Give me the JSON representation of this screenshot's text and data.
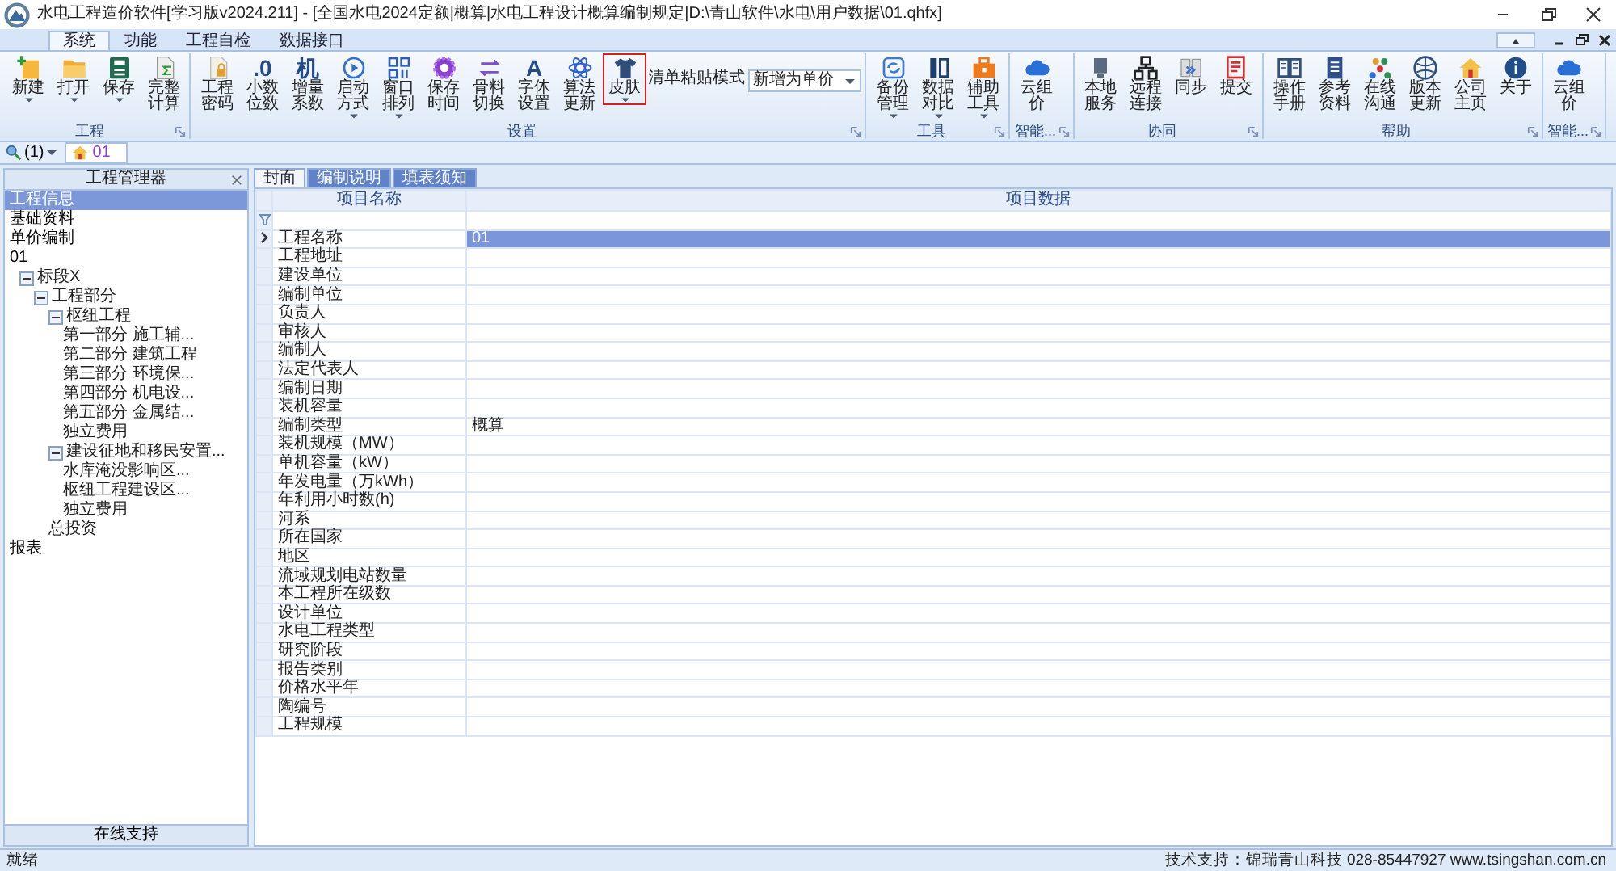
{
  "window": {
    "title": "水电工程造价软件[学习版v2024.211] - [全国水电2024定额|概算|水电工程设计概算编制规定|D:\\青山软件\\水电\\用户数据\\01.qhfx]"
  },
  "ribbon": {
    "tabs": [
      {
        "label": "系统",
        "selected": true
      },
      {
        "label": "功能",
        "selected": false
      },
      {
        "label": "工程自检",
        "selected": false
      },
      {
        "label": "数据接口",
        "selected": false
      }
    ],
    "groups": [
      {
        "label": "工程",
        "items": [
          {
            "label": "新建",
            "kind": "new",
            "dropdown": true,
            "selected": false
          },
          {
            "label": "打开",
            "kind": "folder",
            "dropdown": true,
            "selected": false
          },
          {
            "label": "保存",
            "kind": "disk",
            "dropdown": true,
            "selected": false
          },
          {
            "label": "完整计算",
            "kind": "sigma",
            "dropdown": false,
            "selected": false
          }
        ]
      },
      {
        "label": "设置",
        "items": [
          {
            "label": "工程密码",
            "kind": "lockdoc",
            "dropdown": false,
            "selected": false
          },
          {
            "label": "小数位数",
            "kind": "glyph",
            "glyph": ".0",
            "dropdown": false,
            "selected": false
          },
          {
            "label": "增量系数",
            "kind": "glyph",
            "glyph": "机",
            "dropdown": false,
            "selected": false
          },
          {
            "label": "启动方式",
            "kind": "play",
            "dropdown": true,
            "selected": false
          },
          {
            "label": "窗口排列",
            "kind": "grid",
            "dropdown": true,
            "selected": false
          },
          {
            "label": "保存时间",
            "kind": "gear",
            "dropdown": false,
            "selected": false
          },
          {
            "label": "骨料切换",
            "kind": "swap",
            "dropdown": false,
            "selected": false
          },
          {
            "label": "字体设置",
            "kind": "glyph",
            "glyph": "A",
            "dropdown": false,
            "selected": false
          },
          {
            "label": "算法更新",
            "kind": "atom",
            "dropdown": false,
            "selected": false
          },
          {
            "label": "皮肤",
            "kind": "shirt",
            "dropdown": true,
            "selected": true
          }
        ],
        "combo": {
          "label": "清单粘贴模式",
          "value": "新增为单价"
        }
      },
      {
        "label": "工具",
        "items": [
          {
            "label": "备份管理",
            "kind": "sync",
            "dropdown": true,
            "selected": false
          },
          {
            "label": "数据对比",
            "kind": "columns",
            "dropdown": true,
            "selected": false
          },
          {
            "label": "辅助工具",
            "kind": "toolbox",
            "dropdown": true,
            "selected": false
          }
        ]
      },
      {
        "label": "智能...",
        "items": [
          {
            "label": "云组价",
            "kind": "cloud",
            "dropdown": false,
            "selected": false
          }
        ]
      },
      {
        "label": "协同",
        "items": [
          {
            "label": "本地服务",
            "kind": "server",
            "dropdown": false,
            "selected": false
          },
          {
            "label": "远程连接",
            "kind": "network",
            "dropdown": false,
            "selected": false
          },
          {
            "label": "同步",
            "kind": "bookarrow",
            "dropdown": false,
            "selected": false
          },
          {
            "label": "提交",
            "kind": "redlist",
            "dropdown": false,
            "selected": false
          }
        ]
      },
      {
        "label": "帮助",
        "items": [
          {
            "label": "操作手册",
            "kind": "manual",
            "dropdown": false,
            "selected": false
          },
          {
            "label": "参考资料",
            "kind": "doc",
            "dropdown": false,
            "selected": false
          },
          {
            "label": "在线沟通",
            "kind": "people",
            "dropdown": false,
            "selected": false
          },
          {
            "label": "版本更新",
            "kind": "globe",
            "dropdown": false,
            "selected": false
          },
          {
            "label": "公司主页",
            "kind": "house",
            "dropdown": false,
            "selected": false
          },
          {
            "label": "关于",
            "kind": "info",
            "dropdown": false,
            "selected": false
          }
        ]
      },
      {
        "label": "智能...",
        "items": [
          {
            "label": "云组价",
            "kind": "cloud",
            "dropdown": false,
            "selected": false
          }
        ]
      }
    ]
  },
  "toolbar": {
    "zoom": "(1)",
    "doc_tab": "01"
  },
  "left": {
    "title": "工程管理器",
    "nav": [
      {
        "label": "工程信息",
        "selected": true
      },
      {
        "label": "基础资料",
        "selected": false
      },
      {
        "label": "单价编制",
        "selected": false
      },
      {
        "label": "01",
        "selected": false
      }
    ],
    "tree": [
      {
        "label": "标段X",
        "expanded": true,
        "children": [
          {
            "label": "工程部分",
            "expanded": true,
            "children": [
              {
                "label": "枢纽工程",
                "expanded": true,
                "children": [
                  {
                    "label": "第一部分 施工辅..."
                  },
                  {
                    "label": "第二部分 建筑工程"
                  },
                  {
                    "label": "第三部分 环境保..."
                  },
                  {
                    "label": "第四部分 机电设..."
                  },
                  {
                    "label": "第五部分 金属结..."
                  },
                  {
                    "label": "独立费用"
                  }
                ]
              },
              {
                "label": "建设征地和移民安置...",
                "expanded": true,
                "children": [
                  {
                    "label": "水库淹没影响区..."
                  },
                  {
                    "label": "枢纽工程建设区..."
                  },
                  {
                    "label": "独立费用"
                  }
                ]
              },
              {
                "label": "总投资"
              }
            ]
          }
        ]
      }
    ],
    "footer_nav": [
      {
        "label": "报表",
        "selected": false
      }
    ],
    "support_button": "在线支持"
  },
  "content": {
    "tabs": [
      {
        "label": "封面",
        "selected": true
      },
      {
        "label": "编制说明",
        "selected": false
      },
      {
        "label": "填表须知",
        "selected": false
      }
    ],
    "columns": [
      "项目名称",
      "项目数据"
    ],
    "rows": [
      {
        "name": "工程名称",
        "value": "01",
        "selected": true
      },
      {
        "name": "工程地址",
        "selected": false
      },
      {
        "name": "建设单位",
        "selected": false
      },
      {
        "name": "编制单位",
        "selected": false
      },
      {
        "name": "负责人",
        "selected": false
      },
      {
        "name": "审核人",
        "selected": false
      },
      {
        "name": "编制人",
        "selected": false
      },
      {
        "name": "法定代表人",
        "selected": false
      },
      {
        "name": "编制日期",
        "selected": false
      },
      {
        "name": "装机容量",
        "selected": false
      },
      {
        "name": "编制类型",
        "value": "概算",
        "selected": false
      },
      {
        "name": "装机规模（MW）",
        "selected": false
      },
      {
        "name": "单机容量（kW）",
        "selected": false
      },
      {
        "name": "年发电量（万kWh）",
        "selected": false
      },
      {
        "name": "年利用小时数(h)",
        "selected": false
      },
      {
        "name": "河系",
        "selected": false
      },
      {
        "name": "所在国家",
        "selected": false
      },
      {
        "name": "地区",
        "selected": false
      },
      {
        "name": "流域规划电站数量",
        "selected": false
      },
      {
        "name": "本工程所在级数",
        "selected": false
      },
      {
        "name": "设计单位",
        "selected": false
      },
      {
        "name": "水电工程类型",
        "selected": false
      },
      {
        "name": "研究阶段",
        "selected": false
      },
      {
        "name": "报告类别",
        "selected": false
      },
      {
        "name": "价格水平年",
        "selected": false
      },
      {
        "name": "陶编号",
        "selected": false
      },
      {
        "name": "工程规模",
        "selected": false
      }
    ]
  },
  "status_bar": {
    "left": "就绪",
    "right": "技术支持：锦瑞青山科技 028-85447927 www.tsingshan.com.cn"
  }
}
